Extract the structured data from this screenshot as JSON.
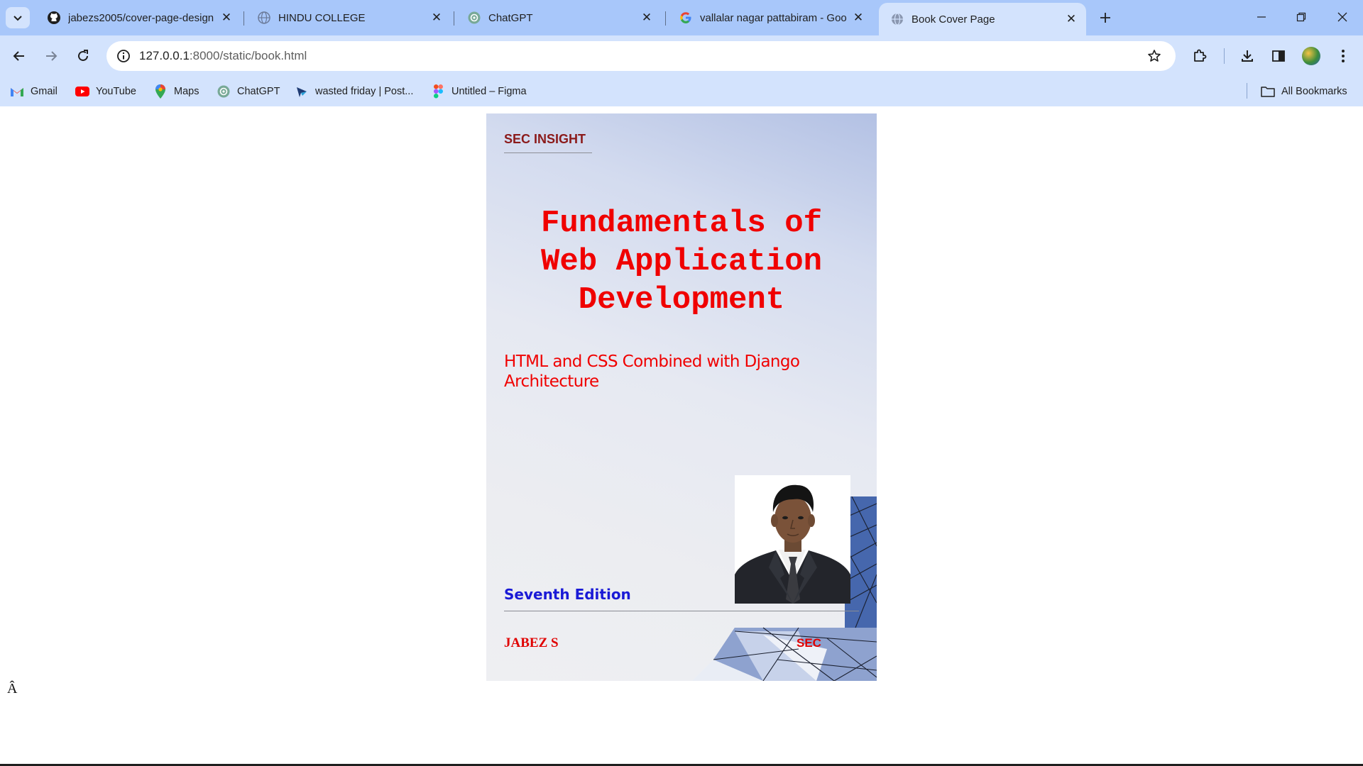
{
  "browser": {
    "tabs": [
      {
        "title": "jabezs2005/cover-page-design",
        "active": false,
        "favicon": "github-icon"
      },
      {
        "title": "HINDU COLLEGE",
        "active": false,
        "favicon": "globe-icon"
      },
      {
        "title": "ChatGPT",
        "active": false,
        "favicon": "chatgpt-icon"
      },
      {
        "title": "vallalar nagar pattabiram - Goo",
        "active": false,
        "favicon": "google-icon"
      },
      {
        "title": "Book Cover Page",
        "active": true,
        "favicon": "globe-icon"
      }
    ],
    "url_host": "127.0.0.1",
    "url_path": ":8000/static/book.html",
    "bookmarks": [
      {
        "label": "Gmail",
        "icon": "gmail-icon"
      },
      {
        "label": "YouTube",
        "icon": "youtube-icon"
      },
      {
        "label": "Maps",
        "icon": "maps-icon"
      },
      {
        "label": "ChatGPT",
        "icon": "chatgpt-icon"
      },
      {
        "label": "wasted friday | Post...",
        "icon": "postman-icon"
      },
      {
        "label": "Untitled – Figma",
        "icon": "figma-icon"
      }
    ],
    "all_bookmarks": "All Bookmarks",
    "theme_color": "#a8c7fa",
    "toolbar_color": "#d3e3fd"
  },
  "page": {
    "publisher": "SEC INSIGHT",
    "title_lines": [
      "Fundamentals of",
      "Web Application",
      "Development"
    ],
    "subtitle": "HTML and CSS Combined with Django Architecture",
    "edition": "Seventh Edition",
    "author": "JABEZ S",
    "logo_text": "SEC",
    "stray_char": "Â",
    "title_color": "#f00000",
    "edition_color": "#1a1ad6"
  }
}
